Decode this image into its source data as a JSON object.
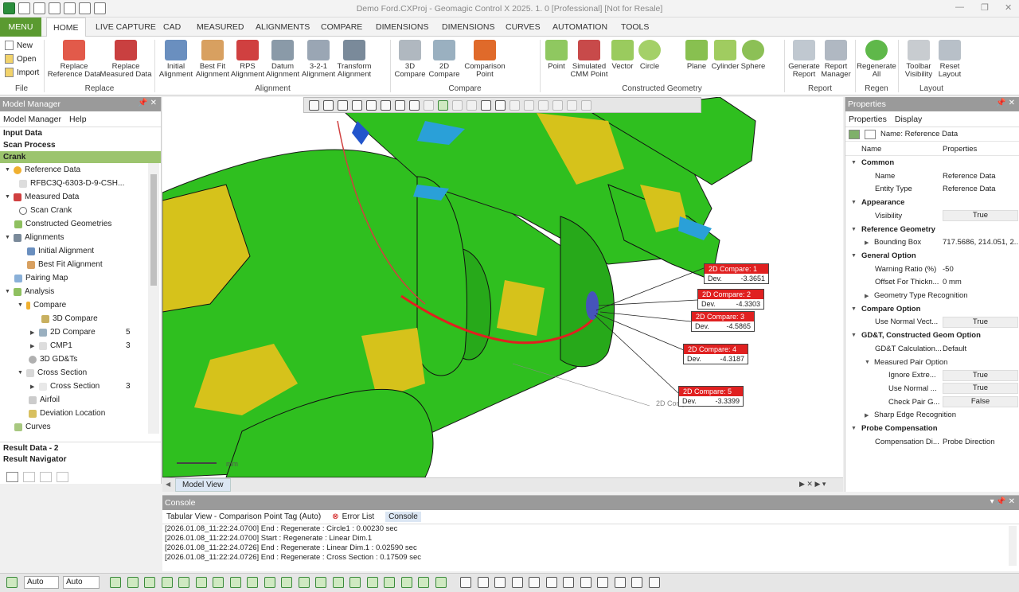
{
  "titlebar": {
    "title": "Demo Ford.CXProj - Geomagic Control X 2025. 1. 0 [Professional] [Not for Resale]"
  },
  "menu": {
    "menu_label": "MENU",
    "tabs": [
      "HOME",
      "LIVE CAPTURE",
      "CAD",
      "MEASURED",
      "ALIGNMENTS",
      "COMPARE",
      "DIMENSIONS",
      "DIMENSIONS",
      "CURVES",
      "AUTOMATION",
      "TOOLS"
    ]
  },
  "ribbon": {
    "file": {
      "new": "New",
      "open": "Open",
      "import": "Import",
      "group": "File"
    },
    "replace": {
      "reference": "Replace\nReference Data",
      "measured": "Replace\nMeasured Data",
      "group": "Replace"
    },
    "alignment": {
      "initial": "Initial\nAlignment",
      "best_fit": "Best Fit\nAlignment",
      "rps": "RPS\nAlignment",
      "datum": "Datum\nAlignment",
      "three21": "3-2-1\nAlignment",
      "transform": "Transform\nAlignment",
      "group": "Alignment"
    },
    "compare": {
      "c3d": "3D\nCompare",
      "c2d": "2D\nCompare",
      "point": "Comparison\nPoint",
      "group": "Compare"
    },
    "constructed": {
      "point": "Point",
      "simulated": "Simulated\nCMM Point",
      "vector": "Vector",
      "circle": "Circle",
      "plane": "Plane",
      "cylinder": "Cylinder",
      "sphere": "Sphere",
      "group": "Constructed Geometry"
    },
    "report": {
      "generate": "Generate\nReport",
      "manager": "Report\nManager",
      "group": "Report"
    },
    "regen": {
      "all": "Regenerate\nAll",
      "group": "Regen"
    },
    "layout": {
      "toolbar": "Toolbar\nVisibility",
      "reset": "Reset\nLayout",
      "group": "Layout"
    }
  },
  "model_manager": {
    "title": "Model Manager",
    "tab_model": "Model Manager",
    "tab_help": "Help",
    "input_data": "Input Data",
    "scan_process": "Scan Process",
    "crank": "Crank",
    "items": [
      "Reference Data",
      "RFBC3Q-6303-D-9-CSH...",
      "Measured Data",
      "Scan Crank",
      "Constructed Geometries",
      "Alignments",
      "Initial Alignment",
      "Best Fit Alignment",
      "Pairing Map",
      "Analysis",
      "Compare",
      "3D Compare",
      "2D Compare",
      "CMP1",
      "3D GD&Ts",
      "Cross Section",
      "Cross Section",
      "Airfoil",
      "Deviation Location",
      "Curves"
    ],
    "counts": {
      "c2d": "5",
      "cmp1": "3",
      "cross": "3"
    },
    "result_data": "Result Data - 2",
    "result_nav": "Result Navigator"
  },
  "view": {
    "tab": "Model View",
    "scale_unit": "mm",
    "compare_ghost": "2D Compare",
    "compares": [
      {
        "title": "2D Compare: 1",
        "label": "Dev.",
        "value": "-3.3651"
      },
      {
        "title": "2D Compare: 2",
        "label": "Dev.",
        "value": "-4.3303"
      },
      {
        "title": "2D Compare: 3",
        "label": "Dev.",
        "value": "-4.5865"
      },
      {
        "title": "2D Compare: 4",
        "label": "Dev.",
        "value": "-4.3187"
      },
      {
        "title": "2D Compare: 5",
        "label": "Dev.",
        "value": "-3.3399"
      }
    ]
  },
  "properties": {
    "title": "Properties",
    "tab_props": "Properties",
    "tab_display": "Display",
    "name_header": "Name: Reference Data",
    "col_name": "Name",
    "col_props": "Properties",
    "rows": [
      {
        "k": "Common",
        "s": 1
      },
      {
        "k": "Name",
        "v": "Reference Data"
      },
      {
        "k": "Entity Type",
        "v": "Reference Data"
      },
      {
        "k": "Appearance",
        "s": 1
      },
      {
        "k": "Visibility",
        "v": "True",
        "b": 1
      },
      {
        "k": "Reference Geometry",
        "s": 1
      },
      {
        "k": "Bounding Box",
        "v": "717.5686, 214.051, 2...",
        "e": 1
      },
      {
        "k": "General Option",
        "s": 1
      },
      {
        "k": "Warning Ratio (%)",
        "v": "-50"
      },
      {
        "k": "Offset For Thickn...",
        "v": "0 mm"
      },
      {
        "k": "Geometry Type Recognition",
        "e": 1
      },
      {
        "k": "Compare Option",
        "s": 1
      },
      {
        "k": "Use Normal Vect...",
        "v": "True",
        "b": 1
      },
      {
        "k": "GD&T, Constructed Geom Option",
        "s": 1
      },
      {
        "k": "GD&T Calculation...",
        "v": "Default"
      },
      {
        "k": "Measured Pair Option",
        "e": 2
      },
      {
        "k": "Ignore Extre...",
        "v": "True",
        "b": 1,
        "d": 2
      },
      {
        "k": "Use Normal ...",
        "v": "True",
        "b": 1,
        "d": 2
      },
      {
        "k": "Check Pair G...",
        "v": "False",
        "b": 1,
        "d": 2
      },
      {
        "k": "Sharp Edge Recognition",
        "e": 1
      },
      {
        "k": "Probe Compensation",
        "s": 1
      },
      {
        "k": "Compensation Di...",
        "v": "Probe Direction"
      }
    ]
  },
  "console": {
    "title": "Console",
    "tab_tabular": "Tabular View - Comparison Point Tag (Auto)",
    "tab_error": "Error List",
    "tab_console": "Console",
    "lines": [
      "[2026.01.08_11:22:24.0700] End : Regenerate : Circle1 : 0.00230 sec",
      "[2026.01.08_11:22:24.0700] Start : Regenerate : Linear Dim.1",
      "[2026.01.08_11:22:24.0726] End : Regenerate : Linear Dim.1 : 0.02590 sec",
      "[2026.01.08_11:22:24.0726] End : Regenerate : Cross Section : 0.17509 sec"
    ]
  },
  "status": {
    "combo1": "Auto",
    "combo2": "Auto"
  },
  "colors": {
    "menu_green": "#5a9a30",
    "crank_green": "#9cc46e",
    "dev_red": "#e02020",
    "mesh_green": "#2fbf1f",
    "mesh_yellow": "#d6c21b"
  }
}
